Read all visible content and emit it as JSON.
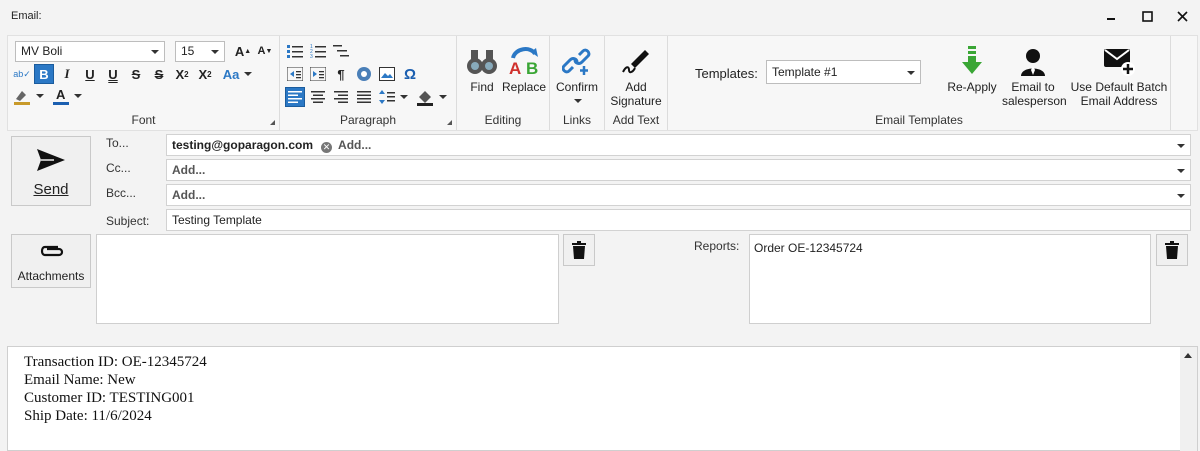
{
  "window": {
    "title": "Email:"
  },
  "ribbon": {
    "font": {
      "label": "Font",
      "font_name": "MV Boli",
      "font_size": "15",
      "case_label": "Aa"
    },
    "paragraph": {
      "label": "Paragraph"
    },
    "editing": {
      "label": "Editing",
      "find": "Find",
      "replace": "Replace"
    },
    "links": {
      "label": "Links",
      "confirm": "Confirm"
    },
    "add_text": {
      "label": "Add Text",
      "add_signature": "Add\nSignature"
    },
    "templates": {
      "label": "Email Templates",
      "templates_label": "Templates:",
      "selected": "Template #1",
      "reapply": "Re-Apply",
      "email_sales": "Email to\nsalesperson",
      "use_default": "Use Default Batch\nEmail Address"
    }
  },
  "compose": {
    "send_label": "Send",
    "to_label": "To...",
    "cc_label": "Cc...",
    "bcc_label": "Bcc...",
    "subject_label": "Subject:",
    "to_recipient": "testing@goparagon.com",
    "add_placeholder": "Add...",
    "subject_value": "Testing Template",
    "attachments_label": "Attachments",
    "reports_label": "Reports:",
    "reports": [
      "Order OE-12345724"
    ]
  },
  "body_lines": [
    "Transaction ID: OE-12345724",
    "Email Name: New",
    "Customer ID: TESTING001",
    "Ship Date: 11/6/2024"
  ],
  "colors": {
    "accent": "#2b78c5",
    "reapply_green": "#3aa635"
  }
}
